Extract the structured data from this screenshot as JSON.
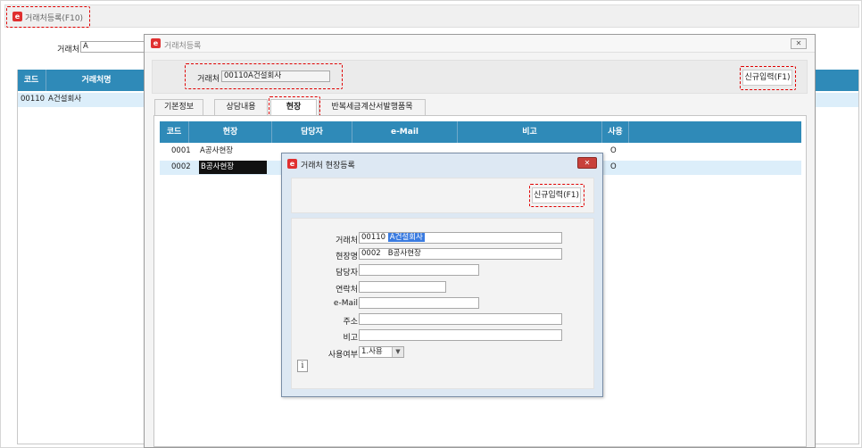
{
  "main": {
    "title_tab": "거래처등록(F10)",
    "filter": {
      "label": "거래처",
      "value": "A"
    },
    "columns": [
      "코드",
      "거래처명"
    ],
    "rows": [
      {
        "code": "00110",
        "name": "A건설회사"
      }
    ]
  },
  "dialog": {
    "title": "거래처등록",
    "close_icon": "close-icon",
    "header": {
      "label": "거래처",
      "value": "00110A건설회사",
      "new_button": "신규입력(F1)"
    },
    "tabs": [
      "기본정보",
      "상담내용",
      "현장",
      "반복세금계산서발행품목"
    ],
    "active_tab": 2,
    "grid": {
      "columns": [
        "코드",
        "현장",
        "담당자",
        "e-Mail",
        "비고",
        "사용"
      ],
      "rows": [
        {
          "code": "0001",
          "site": "A공사현장",
          "use": "O"
        },
        {
          "code": "0002",
          "site": "B공사현장",
          "use": "O"
        }
      ]
    }
  },
  "popup": {
    "title": "거래처 현장등록",
    "new_button": "신규입력(F1)",
    "fields": {
      "client": {
        "label": "거래처",
        "code": "00110",
        "name": "A건설회사"
      },
      "site": {
        "label": "현장명",
        "value": "0002   B공사현장"
      },
      "manager": {
        "label": "담당자",
        "value": ""
      },
      "contact": {
        "label": "연락처",
        "value": ""
      },
      "email": {
        "label": "e-Mail",
        "value": ""
      },
      "address": {
        "label": "주소",
        "value": ""
      },
      "note": {
        "label": "비고",
        "value": ""
      },
      "use": {
        "label": "사용여부",
        "value": "1.사용"
      }
    },
    "info_icon": "info-icon"
  },
  "colors": {
    "header_blue": "#2f8ab8",
    "highlight_red": "#e00000",
    "selected_row": "#dceefa"
  }
}
